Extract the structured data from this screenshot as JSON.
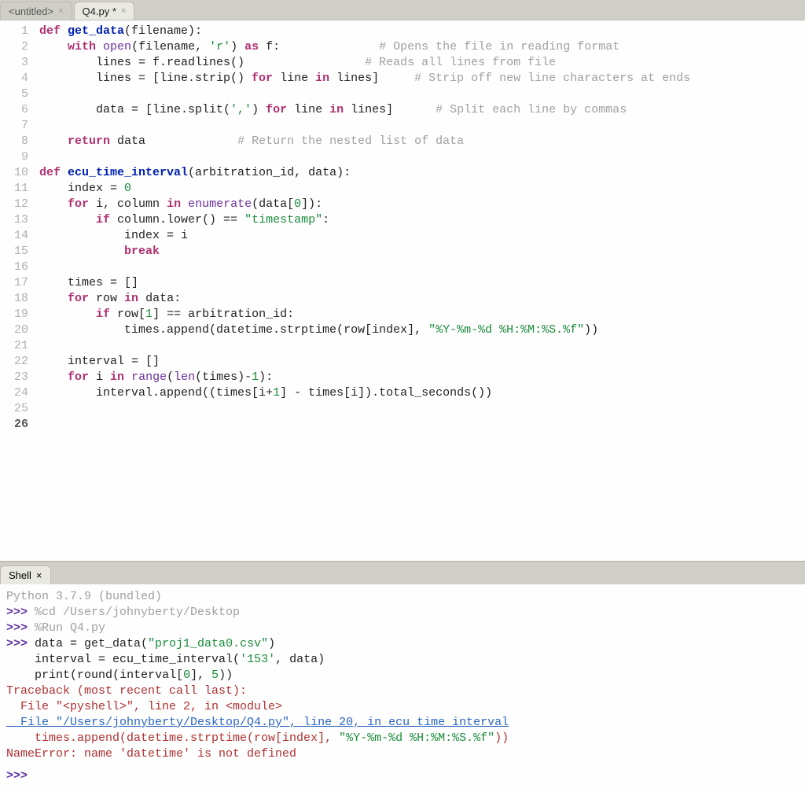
{
  "tabs": [
    {
      "label": "<untitled>",
      "active": false
    },
    {
      "label": "Q4.py *",
      "active": true
    }
  ],
  "gutter": {
    "total": 26,
    "current": 26
  },
  "code_tokens": [
    [
      {
        "t": "def ",
        "c": "kw"
      },
      {
        "t": "get_data",
        "c": "fn"
      },
      {
        "t": "(filename):",
        "c": "op"
      }
    ],
    [
      {
        "t": "    ",
        "c": ""
      },
      {
        "t": "with",
        "c": "kw"
      },
      {
        "t": " ",
        "c": ""
      },
      {
        "t": "open",
        "c": "call"
      },
      {
        "t": "(filename, ",
        "c": "op"
      },
      {
        "t": "'r'",
        "c": "str"
      },
      {
        "t": ") ",
        "c": "op"
      },
      {
        "t": "as",
        "c": "kw"
      },
      {
        "t": " f:              ",
        "c": "op"
      },
      {
        "t": "# Opens the file in reading format",
        "c": "com"
      }
    ],
    [
      {
        "t": "        lines = f.readlines()                 ",
        "c": "op"
      },
      {
        "t": "# Reads all lines from file",
        "c": "com"
      }
    ],
    [
      {
        "t": "        lines = [line.strip() ",
        "c": "op"
      },
      {
        "t": "for",
        "c": "kw"
      },
      {
        "t": " line ",
        "c": "op"
      },
      {
        "t": "in",
        "c": "kw"
      },
      {
        "t": " lines]     ",
        "c": "op"
      },
      {
        "t": "# Strip off new line characters at ends",
        "c": "com"
      }
    ],
    [],
    [
      {
        "t": "        data = [line.split(",
        "c": "op"
      },
      {
        "t": "','",
        "c": "str"
      },
      {
        "t": ") ",
        "c": "op"
      },
      {
        "t": "for",
        "c": "kw"
      },
      {
        "t": " line ",
        "c": "op"
      },
      {
        "t": "in",
        "c": "kw"
      },
      {
        "t": " lines]      ",
        "c": "op"
      },
      {
        "t": "# Split each line by commas",
        "c": "com"
      }
    ],
    [],
    [
      {
        "t": "    ",
        "c": ""
      },
      {
        "t": "return",
        "c": "kw"
      },
      {
        "t": " data             ",
        "c": "op"
      },
      {
        "t": "# Return the nested list of data",
        "c": "com"
      }
    ],
    [],
    [
      {
        "t": "def ",
        "c": "kw"
      },
      {
        "t": "ecu_time_interval",
        "c": "fn"
      },
      {
        "t": "(arbitration_id, data):",
        "c": "op"
      }
    ],
    [
      {
        "t": "    index = ",
        "c": "op"
      },
      {
        "t": "0",
        "c": "num"
      }
    ],
    [
      {
        "t": "    ",
        "c": ""
      },
      {
        "t": "for",
        "c": "kw"
      },
      {
        "t": " i, column ",
        "c": "op"
      },
      {
        "t": "in",
        "c": "kw"
      },
      {
        "t": " ",
        "c": ""
      },
      {
        "t": "enumerate",
        "c": "call"
      },
      {
        "t": "(data[",
        "c": "op"
      },
      {
        "t": "0",
        "c": "num"
      },
      {
        "t": "]):",
        "c": "op"
      }
    ],
    [
      {
        "t": "        ",
        "c": ""
      },
      {
        "t": "if",
        "c": "kw"
      },
      {
        "t": " column.lower() == ",
        "c": "op"
      },
      {
        "t": "\"timestamp\"",
        "c": "str"
      },
      {
        "t": ":",
        "c": "op"
      }
    ],
    [
      {
        "t": "            index = i",
        "c": "op"
      }
    ],
    [
      {
        "t": "            ",
        "c": ""
      },
      {
        "t": "break",
        "c": "kw"
      }
    ],
    [],
    [
      {
        "t": "    times = []",
        "c": "op"
      }
    ],
    [
      {
        "t": "    ",
        "c": ""
      },
      {
        "t": "for",
        "c": "kw"
      },
      {
        "t": " row ",
        "c": "op"
      },
      {
        "t": "in",
        "c": "kw"
      },
      {
        "t": " data:",
        "c": "op"
      }
    ],
    [
      {
        "t": "        ",
        "c": ""
      },
      {
        "t": "if",
        "c": "kw"
      },
      {
        "t": " row[",
        "c": "op"
      },
      {
        "t": "1",
        "c": "num"
      },
      {
        "t": "] == arbitration_id:",
        "c": "op"
      }
    ],
    [
      {
        "t": "            times.append(datetime.strptime(row[index], ",
        "c": "op"
      },
      {
        "t": "\"%Y-%m-%d %H:%M:%S.%f\"",
        "c": "str"
      },
      {
        "t": "))",
        "c": "op"
      }
    ],
    [],
    [
      {
        "t": "    interval = []",
        "c": "op"
      }
    ],
    [
      {
        "t": "    ",
        "c": ""
      },
      {
        "t": "for",
        "c": "kw"
      },
      {
        "t": " i ",
        "c": "op"
      },
      {
        "t": "in",
        "c": "kw"
      },
      {
        "t": " ",
        "c": ""
      },
      {
        "t": "range",
        "c": "call"
      },
      {
        "t": "(",
        "c": "op"
      },
      {
        "t": "len",
        "c": "call"
      },
      {
        "t": "(times)-",
        "c": "op"
      },
      {
        "t": "1",
        "c": "num"
      },
      {
        "t": "):",
        "c": "op"
      }
    ],
    [
      {
        "t": "        interval.append((times[i+",
        "c": "op"
      },
      {
        "t": "1",
        "c": "num"
      },
      {
        "t": "] - times[i]).total_seconds())",
        "c": "op"
      }
    ],
    [],
    []
  ],
  "shell": {
    "tab_label": "Shell",
    "version": "Python 3.7.9 (bundled)",
    "prompt": ">>>",
    "lines": [
      {
        "kind": "cmd",
        "text": "%cd /Users/johnyberty/Desktop"
      },
      {
        "kind": "cmd",
        "text": "%Run Q4.py"
      },
      {
        "kind": "cmd_multiline",
        "parts": [
          [
            {
              "t": "data = get_data(",
              "c": "sh-input"
            },
            {
              "t": "\"proj1_data0.csv\"",
              "c": "sh-str"
            },
            {
              "t": ")",
              "c": "sh-input"
            }
          ],
          [
            {
              "t": "interval = ecu_time_interval(",
              "c": "sh-input"
            },
            {
              "t": "'153'",
              "c": "sh-str"
            },
            {
              "t": ", data)",
              "c": "sh-input"
            }
          ],
          [
            {
              "t": "print",
              "c": "sh-input"
            },
            {
              "t": "(",
              "c": "sh-input"
            },
            {
              "t": "round",
              "c": "sh-input"
            },
            {
              "t": "(interval[",
              "c": "sh-input"
            },
            {
              "t": "0",
              "c": "sh-str"
            },
            {
              "t": "], ",
              "c": "sh-input"
            },
            {
              "t": "5",
              "c": "sh-str"
            },
            {
              "t": "))",
              "c": "sh-input"
            }
          ]
        ]
      },
      {
        "kind": "err",
        "text": "Traceback (most recent call last):"
      },
      {
        "kind": "err",
        "text": "  File \"<pyshell>\", line 2, in <module>"
      },
      {
        "kind": "link",
        "text": "  File \"/Users/johnyberty/Desktop/Q4.py\", line 20, in ecu_time_interval"
      },
      {
        "kind": "err_code",
        "parts": [
          {
            "t": "    times.append(datetime.strptime(row[index], ",
            "c": "sh-err"
          },
          {
            "t": "\"%Y-%m-%d %H:%M:%S.%f\"",
            "c": "sh-str"
          },
          {
            "t": "))",
            "c": "sh-err"
          }
        ]
      },
      {
        "kind": "err",
        "text": "NameError: name 'datetime' is not defined"
      }
    ]
  }
}
